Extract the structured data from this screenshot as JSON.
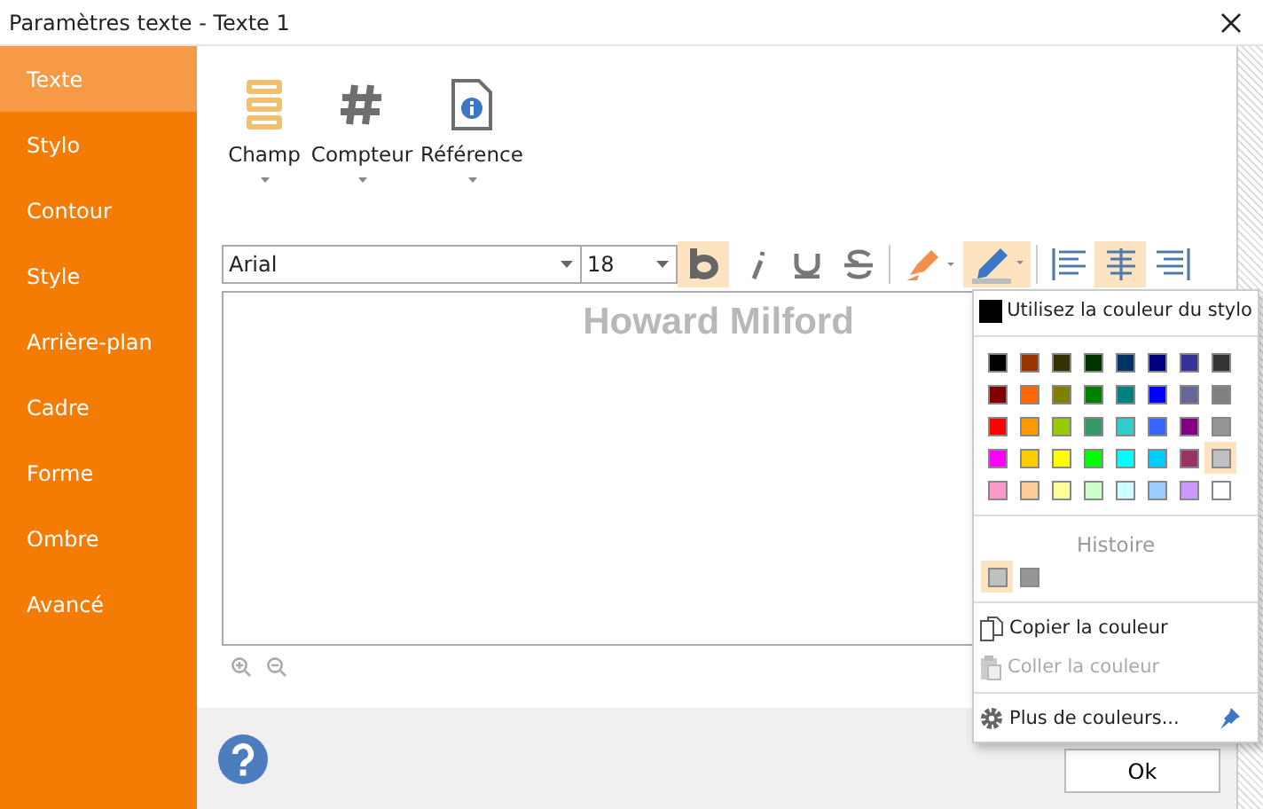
{
  "window": {
    "title": "Paramètres texte - Texte 1"
  },
  "sidebar": {
    "items": [
      {
        "label": "Texte",
        "selected": true
      },
      {
        "label": "Stylo",
        "selected": false
      },
      {
        "label": "Contour",
        "selected": false
      },
      {
        "label": "Style",
        "selected": false
      },
      {
        "label": "Arrière-plan",
        "selected": false
      },
      {
        "label": "Cadre",
        "selected": false
      },
      {
        "label": "Forme",
        "selected": false
      },
      {
        "label": "Ombre",
        "selected": false
      },
      {
        "label": "Avancé",
        "selected": false
      }
    ]
  },
  "insert_buttons": [
    {
      "label": "Champ",
      "kind": "field"
    },
    {
      "label": "Compteur",
      "kind": "counter"
    },
    {
      "label": "Référence",
      "kind": "reference"
    }
  ],
  "format_toolbar": {
    "font": "Arial",
    "size": "18",
    "buttons": [
      {
        "kind": "bold",
        "selected": true
      },
      {
        "kind": "italic",
        "selected": false
      },
      {
        "kind": "underline",
        "selected": false
      },
      {
        "kind": "strike",
        "selected": false
      },
      {
        "kind": "highlight",
        "selected": false
      },
      {
        "kind": "pen",
        "selected": true
      },
      {
        "kind": "align_left",
        "selected": false
      },
      {
        "kind": "align_center",
        "selected": true
      },
      {
        "kind": "align_right",
        "selected": false
      }
    ]
  },
  "editor": {
    "text": "Howard Milford"
  },
  "color_menu": {
    "use_pen_color": "Utilisez la couleur du stylo",
    "swatches": [
      {
        "color": "#000000",
        "selected": false
      },
      {
        "color": "#993300",
        "selected": false
      },
      {
        "color": "#333300",
        "selected": false
      },
      {
        "color": "#003300",
        "selected": false
      },
      {
        "color": "#003366",
        "selected": false
      },
      {
        "color": "#000080",
        "selected": false
      },
      {
        "color": "#333399",
        "selected": false
      },
      {
        "color": "#333333",
        "selected": false
      },
      {
        "color": "#800000",
        "selected": false
      },
      {
        "color": "#ff6600",
        "selected": false
      },
      {
        "color": "#808000",
        "selected": false
      },
      {
        "color": "#008000",
        "selected": false
      },
      {
        "color": "#008080",
        "selected": false
      },
      {
        "color": "#0000ff",
        "selected": false
      },
      {
        "color": "#666699",
        "selected": false
      },
      {
        "color": "#808080",
        "selected": false
      },
      {
        "color": "#ff0000",
        "selected": false
      },
      {
        "color": "#ff9900",
        "selected": false
      },
      {
        "color": "#99cc00",
        "selected": false
      },
      {
        "color": "#339966",
        "selected": false
      },
      {
        "color": "#33cccc",
        "selected": false
      },
      {
        "color": "#3366ff",
        "selected": false
      },
      {
        "color": "#800080",
        "selected": false
      },
      {
        "color": "#969696",
        "selected": false
      },
      {
        "color": "#ff00ff",
        "selected": false
      },
      {
        "color": "#ffcc00",
        "selected": false
      },
      {
        "color": "#ffff00",
        "selected": false
      },
      {
        "color": "#00ff00",
        "selected": false
      },
      {
        "color": "#00ffff",
        "selected": false
      },
      {
        "color": "#00ccff",
        "selected": false
      },
      {
        "color": "#993366",
        "selected": false
      },
      {
        "color": "#c0c0c0",
        "selected": true
      },
      {
        "color": "#ff99cc",
        "selected": false
      },
      {
        "color": "#ffcc99",
        "selected": false
      },
      {
        "color": "#ffff99",
        "selected": false
      },
      {
        "color": "#ccffcc",
        "selected": false
      },
      {
        "color": "#ccffff",
        "selected": false
      },
      {
        "color": "#99ccff",
        "selected": false
      },
      {
        "color": "#cc99ff",
        "selected": false
      },
      {
        "color": "#ffffff",
        "selected": false
      }
    ],
    "history_title": "Histoire",
    "history": [
      {
        "color": "#c0c0c0",
        "selected": true
      },
      {
        "color": "#969696",
        "selected": false
      }
    ],
    "actions": [
      {
        "label": "Copier la couleur",
        "kind": "copy",
        "disabled": false
      },
      {
        "label": "Coller la couleur",
        "kind": "paste",
        "disabled": true
      },
      {
        "label": "Plus de couleurs...",
        "kind": "more",
        "disabled": false
      }
    ]
  },
  "footer": {
    "ok": "Ok"
  }
}
